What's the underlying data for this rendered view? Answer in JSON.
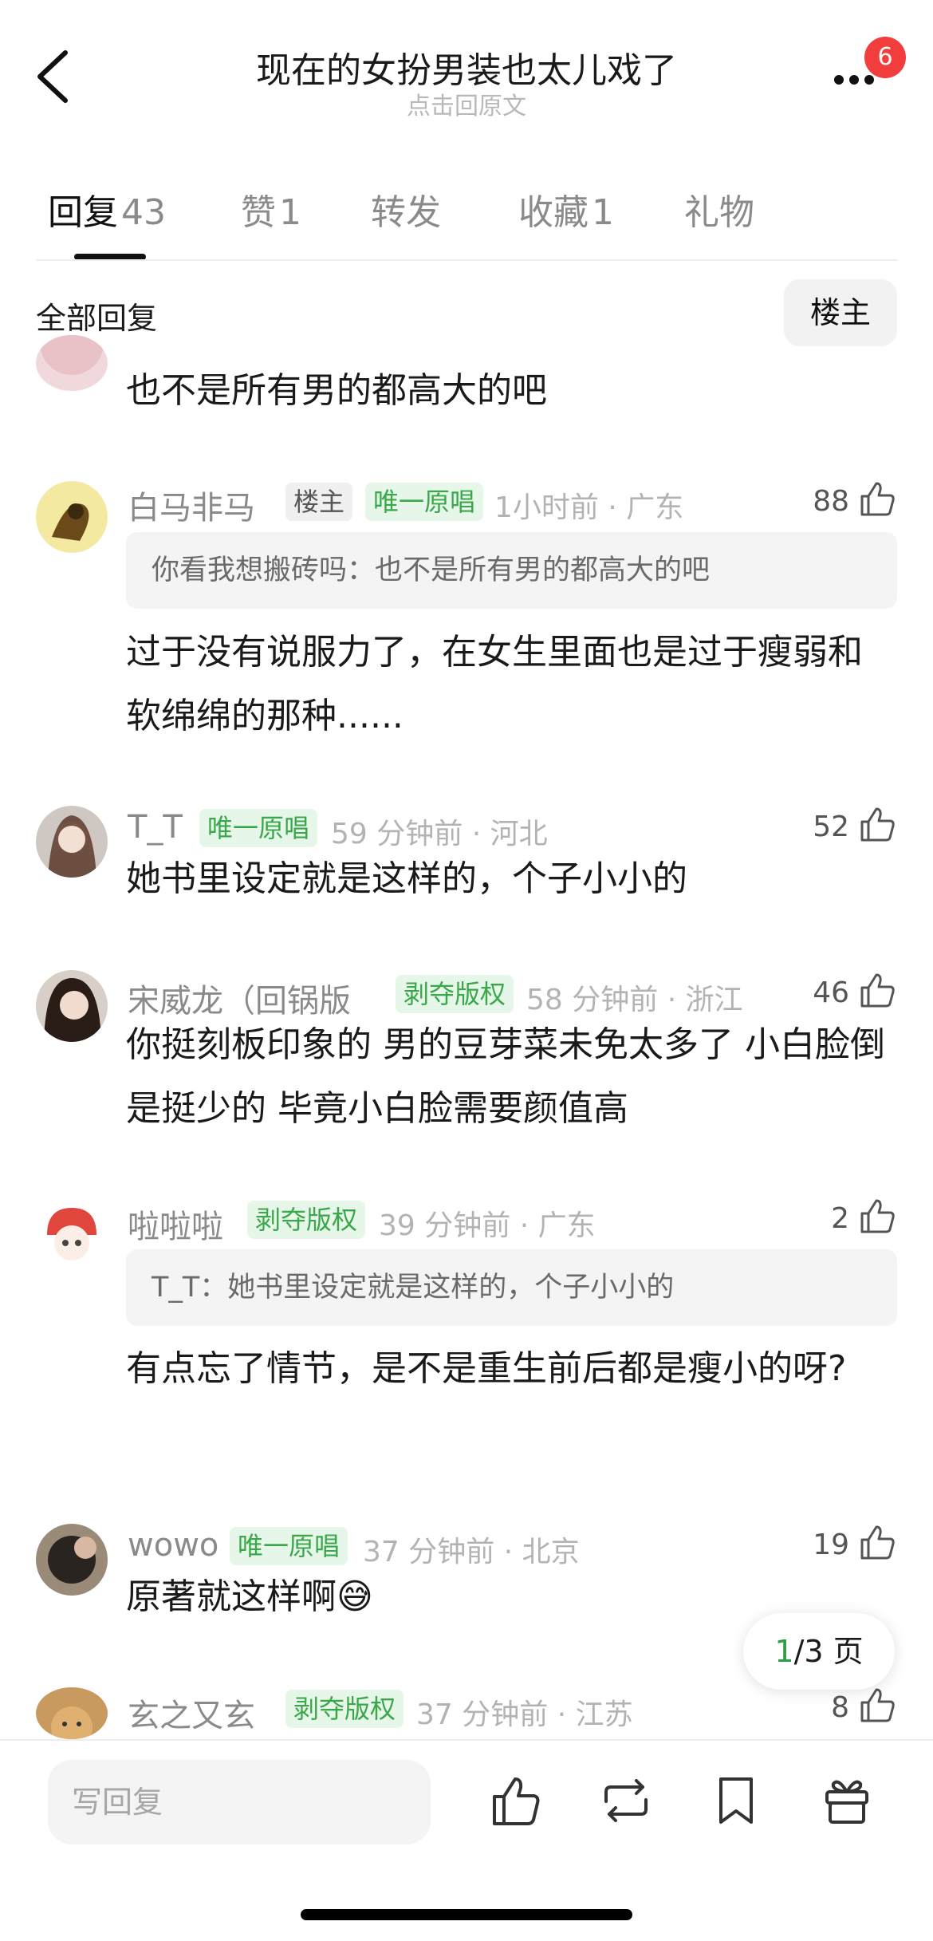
{
  "header": {
    "title": "现在的女扮男装也太儿戏了",
    "subtitle": "点击回原文",
    "notification_count": "6"
  },
  "tabs": [
    {
      "label": "回复",
      "count": "43"
    },
    {
      "label": "赞",
      "count": "1"
    },
    {
      "label": "转发",
      "count": ""
    },
    {
      "label": "收藏",
      "count": "1"
    },
    {
      "label": "礼物",
      "count": ""
    }
  ],
  "filter": {
    "all_replies": "全部回复",
    "op_only": "楼主"
  },
  "comments": [
    {
      "body": "也不是所有男的都高大的吧"
    },
    {
      "username": "白马非马",
      "tags": [
        "楼主",
        "唯一原唱"
      ],
      "meta": "1小时前 · 广东",
      "likes": "88",
      "quote": "你看我想搬砖吗：也不是所有男的都高大的吧",
      "body": "过于没有说服力了，在女生里面也是过于瘦弱和软绵绵的那种......"
    },
    {
      "username": "T_T",
      "tags": [
        "唯一原唱"
      ],
      "meta": "59 分钟前 · 河北",
      "likes": "52",
      "body": "她书里设定就是这样的，个子小小的"
    },
    {
      "username": "宋威龙（回锅版",
      "tags": [
        "剥夺版权"
      ],
      "meta": "58 分钟前 · 浙江",
      "likes": "46",
      "body": "你挺刻板印象的 男的豆芽菜未免太多了 小白脸倒是挺少的 毕竟小白脸需要颜值高"
    },
    {
      "username": "啦啦啦",
      "tags": [
        "剥夺版权"
      ],
      "meta": "39 分钟前 · 广东",
      "likes": "2",
      "quote": "T_T：她书里设定就是这样的，个子小小的",
      "body": "有点忘了情节，是不是重生前后都是瘦小的呀?"
    },
    {
      "username": "wowo",
      "tags": [
        "唯一原唱"
      ],
      "meta": "37 分钟前 · 北京",
      "likes": "19",
      "body": "原著就这样啊😅"
    },
    {
      "username": "玄之又玄",
      "tags": [
        "剥夺版权"
      ],
      "meta": "37 分钟前 · 江苏",
      "likes": "8"
    }
  ],
  "pagination": {
    "current": "1",
    "rest": "/3 页"
  },
  "bottom_bar": {
    "reply_placeholder": "写回复"
  },
  "colors": {
    "accent_green": "#3aa84a",
    "badge_red": "#f23d3d",
    "muted_gray": "#8a8a8a"
  }
}
